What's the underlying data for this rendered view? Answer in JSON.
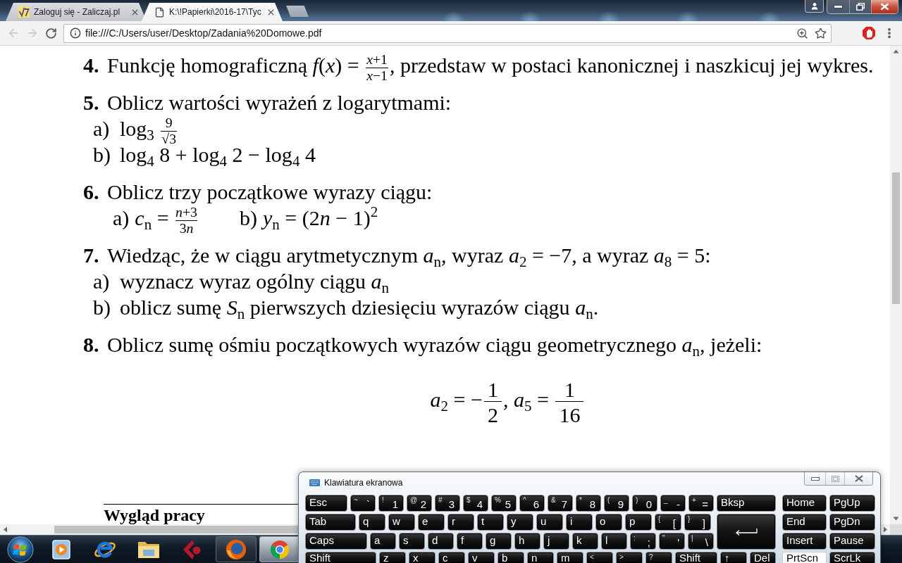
{
  "browser": {
    "tabs": [
      {
        "kind": "site",
        "title": "Zaloguj się - Zaliczaj.pl",
        "selected": false
      },
      {
        "kind": "file",
        "title": "K:\\!Papierki\\2016-17\\Tyc",
        "selected": true
      }
    ],
    "back": {
      "disabled": true
    },
    "forward": {
      "disabled": true
    },
    "address": "file:///C:/Users/user/Desktop/Zadania%20Domowe.pdf"
  },
  "document": {
    "problems": [
      {
        "number": "4.",
        "text": [
          {
            "kind": "text",
            "text": "Funkcję homograficzną *f*(*x*) = "
          },
          {
            "kind": "frac",
            "num": [
              "*x*+1"
            ],
            "den": [
              "*x*−1"
            ]
          },
          {
            "kind": "text",
            "text": ", przedstaw w postaci kanonicznej i naszkicuj jej wykres."
          }
        ]
      },
      {
        "number": "5.",
        "text": [
          {
            "kind": "text",
            "text": "Oblicz wartości wyrażeń z logarytmami:"
          }
        ],
        "inline_items": false,
        "items": [
          {
            "label": "a)",
            "text": [
              {
                "kind": "text",
                "text": "log$_{3}$ "
              },
              {
                "kind": "frac",
                "num": [
                  "9"
                ],
                "den": [
                  "√3"
                ]
              }
            ]
          },
          {
            "label": "b)",
            "text": [
              {
                "kind": "text",
                "text": "log$_{4}$ 8 + log$_{4}$ 2 − log$_{4}$ 4"
              }
            ]
          }
        ]
      },
      {
        "number": "6.",
        "text": [
          {
            "kind": "text",
            "text": "Oblicz trzy początkowe wyrazy ciągu:"
          }
        ],
        "inline_items": true,
        "items": [
          {
            "label": "a)",
            "text": [
              {
                "kind": "text",
                "text": "*c*$_{n}$ = "
              },
              {
                "kind": "frac",
                "num": [
                  "*n*+3"
                ],
                "den": [
                  "3",
                  "*n*"
                ]
              }
            ]
          },
          {
            "label": "b)",
            "text": [
              {
                "kind": "text",
                "text": "*y*$_{n}$ = (2"
              },
              {
                "kind": "text",
                "text": "*n* − 1)$^{2}$"
              }
            ]
          }
        ]
      },
      {
        "number": "7.",
        "text": [
          {
            "kind": "text",
            "text": "Wiedząc, że w ciągu arytmetycznym *a*$_{n}$, wyraz *a*$_{2}$ = −7, a wyraz *a*$_{8}$ = 5:"
          }
        ],
        "inline_items": false,
        "items": [
          {
            "label": "a)",
            "text": [
              {
                "kind": "text",
                "text": "wyznacz wyraz ogólny ciągu *a*$_{n}$"
              }
            ]
          },
          {
            "label": "b)",
            "text": [
              {
                "kind": "text",
                "text": "oblicz sumę *S*$_{n}$ pierwszych dziesięciu wyrazów ciągu *a*$_{n}$."
              }
            ]
          }
        ]
      },
      {
        "number": "8.",
        "text": [
          {
            "kind": "text",
            "text": "Oblicz sumę ośmiu początkowych wyrazów ciągu geometrycznego *a*$_{n}$, jeżeli:"
          }
        ],
        "display": [
          {
            "kind": "text",
            "text": "*a*$_{2}$ = −"
          },
          {
            "kind": "frac",
            "num": [
              "1"
            ],
            "den": [
              "2"
            ]
          },
          {
            "kind": "text",
            "text": ", *a*$_{5}$ = "
          },
          {
            "kind": "frac",
            "num": [
              "1"
            ],
            "den": [
              "16"
            ]
          }
        ]
      }
    ],
    "section_heading": "Wygląd pracy"
  },
  "keyboard": {
    "title": "Klawiatura ekranowa",
    "rows": [
      {
        "keys": [
          {
            "kind": "label",
            "label": "Esc",
            "pressed": false
          },
          {
            "kind": "dual",
            "top": "~",
            "main": "`",
            "pressed": false
          },
          {
            "kind": "dual",
            "top": "!",
            "main": "1",
            "pressed": false
          },
          {
            "kind": "dual",
            "top": "@",
            "main": "2",
            "pressed": false
          },
          {
            "kind": "dual",
            "top": "#",
            "main": "3",
            "pressed": false
          },
          {
            "kind": "dual",
            "top": "$",
            "main": "4",
            "pressed": false
          },
          {
            "kind": "dual",
            "top": "%",
            "main": "5",
            "pressed": false
          },
          {
            "kind": "dual",
            "top": "^",
            "main": "6",
            "pressed": false
          },
          {
            "kind": "dual",
            "top": "&",
            "main": "7",
            "pressed": false
          },
          {
            "kind": "dual",
            "top": "*",
            "main": "8",
            "pressed": false
          },
          {
            "kind": "dual",
            "top": "(",
            "main": "9",
            "pressed": false
          },
          {
            "kind": "dual",
            "top": ")",
            "main": "0",
            "pressed": false
          },
          {
            "kind": "dual",
            "top": "_",
            "main": "-",
            "pressed": false
          },
          {
            "kind": "dual",
            "top": "+",
            "main": "=",
            "pressed": false
          },
          {
            "kind": "label",
            "label": "Bksp",
            "pressed": false
          }
        ]
      },
      {
        "keys": [
          {
            "kind": "label",
            "label": "Tab",
            "pressed": false
          },
          {
            "kind": "label",
            "label": "q",
            "pressed": false
          },
          {
            "kind": "label",
            "label": "w",
            "pressed": false
          },
          {
            "kind": "label",
            "label": "e",
            "pressed": false
          },
          {
            "kind": "label",
            "label": "r",
            "pressed": false
          },
          {
            "kind": "label",
            "label": "t",
            "pressed": false
          },
          {
            "kind": "label",
            "label": "y",
            "pressed": false
          },
          {
            "kind": "label",
            "label": "u",
            "pressed": false
          },
          {
            "kind": "label",
            "label": "i",
            "pressed": false
          },
          {
            "kind": "label",
            "label": "o",
            "pressed": false
          },
          {
            "kind": "label",
            "label": "p",
            "pressed": false
          },
          {
            "kind": "dual",
            "top": "{",
            "main": "[",
            "pressed": false
          },
          {
            "kind": "dual",
            "top": "}",
            "main": "]",
            "pressed": false
          },
          {
            "kind": "enter",
            "pressed": false
          }
        ]
      },
      {
        "keys": [
          {
            "kind": "label",
            "label": "Caps",
            "pressed": false
          },
          {
            "kind": "label",
            "label": "a",
            "pressed": false
          },
          {
            "kind": "label",
            "label": "s",
            "pressed": false
          },
          {
            "kind": "label",
            "label": "d",
            "pressed": false
          },
          {
            "kind": "label",
            "label": "f",
            "pressed": false
          },
          {
            "kind": "label",
            "label": "g",
            "pressed": false
          },
          {
            "kind": "label",
            "label": "h",
            "pressed": false
          },
          {
            "kind": "label",
            "label": "j",
            "pressed": false
          },
          {
            "kind": "label",
            "label": "k",
            "pressed": false
          },
          {
            "kind": "label",
            "label": "l",
            "pressed": false
          },
          {
            "kind": "dual",
            "top": ":",
            "main": ";",
            "pressed": false
          },
          {
            "kind": "dual",
            "top": "\"",
            "main": "'",
            "pressed": false
          },
          {
            "kind": "dual",
            "top": "|",
            "main": "\\",
            "pressed": false
          }
        ]
      },
      {
        "keys": [
          {
            "kind": "label",
            "label": "Shift",
            "pressed": false
          },
          {
            "kind": "label",
            "label": "z",
            "pressed": false
          },
          {
            "kind": "label",
            "label": "x",
            "pressed": false
          },
          {
            "kind": "label",
            "label": "c",
            "pressed": false
          },
          {
            "kind": "label",
            "label": "v",
            "pressed": false
          },
          {
            "kind": "label",
            "label": "b",
            "pressed": false
          },
          {
            "kind": "label",
            "label": "n",
            "pressed": false
          },
          {
            "kind": "label",
            "label": "m",
            "pressed": false
          },
          {
            "kind": "symbol",
            "label": "<",
            "pressed": false
          },
          {
            "kind": "symbol",
            "label": ">",
            "pressed": false
          },
          {
            "kind": "symbol",
            "label": "?",
            "pressed": false
          },
          {
            "kind": "label",
            "label": "Shift",
            "pressed": false
          },
          {
            "kind": "label",
            "label": "↑",
            "pressed": false
          },
          {
            "kind": "label",
            "label": "Del",
            "pressed": false
          }
        ]
      }
    ],
    "nav_rows": [
      {
        "keys": [
          {
            "kind": "label",
            "label": "Home",
            "pressed": false
          },
          {
            "kind": "label",
            "label": "PgUp",
            "pressed": false
          }
        ]
      },
      {
        "keys": [
          {
            "kind": "label",
            "label": "End",
            "pressed": false
          },
          {
            "kind": "label",
            "label": "PgDn",
            "pressed": false
          }
        ]
      },
      {
        "keys": [
          {
            "kind": "label",
            "label": "Insert",
            "pressed": false
          },
          {
            "kind": "label",
            "label": "Pause",
            "pressed": false
          }
        ]
      },
      {
        "keys": [
          {
            "kind": "label",
            "label": "PrtScn",
            "pressed": true
          },
          {
            "kind": "label",
            "label": "ScrLk",
            "pressed": false
          }
        ]
      }
    ]
  },
  "taskbar": {
    "items": [
      {
        "kind": "player",
        "running": false,
        "selected": false
      },
      {
        "kind": "browser-e",
        "running": false,
        "selected": false
      },
      {
        "kind": "folder",
        "running": false,
        "selected": false
      },
      {
        "kind": "arrowhead",
        "running": false,
        "selected": false
      },
      {
        "kind": "fox",
        "running": true,
        "selected": false
      },
      {
        "kind": "ring",
        "running": true,
        "selected": true
      }
    ]
  }
}
